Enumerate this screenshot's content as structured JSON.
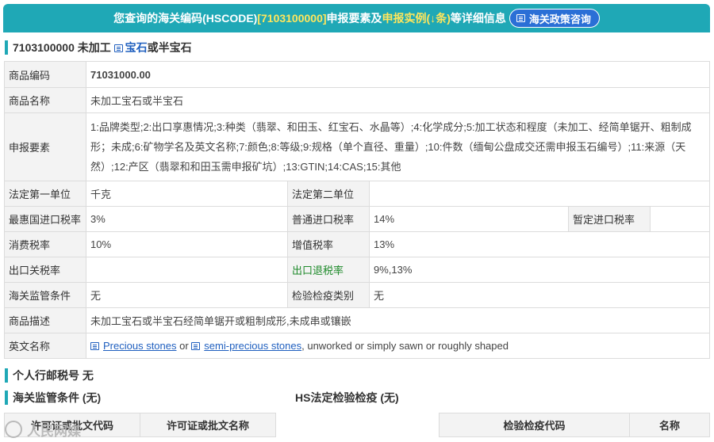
{
  "header": {
    "prefix": "您查询的海关编码(HSCODE)",
    "code_bracket": "[7103100000]",
    "mid": " 申报要素及",
    "example_link": "申报实例(↓条)",
    "suffix": "等详细信息",
    "policy_button": "海关政策咨询"
  },
  "title": {
    "code": "7103100000 未加工",
    "link": "宝石",
    "rest": "或半宝石"
  },
  "labels": {
    "code": "商品编码",
    "name": "商品名称",
    "elements": "申报要素",
    "unit1": "法定第一单位",
    "unit2": "法定第二单位",
    "mfn": "最惠国进口税率",
    "general": "普通进口税率",
    "provisional": "暂定进口税率",
    "consumption": "消费税率",
    "vat": "增值税率",
    "export_tax": "出口关税率",
    "export_rebate": "出口退税率",
    "supervision": "海关监管条件",
    "inspection": "检验检疫类别",
    "description": "商品描述",
    "english_name": "英文名称"
  },
  "values": {
    "code": "71031000.00",
    "name": "未加工宝石或半宝石",
    "elements": "1:品牌类型;2:出口享惠情况;3:种类（翡翠、和田玉、红宝石、水晶等）;4:化学成分;5:加工状态和程度（未加工、经简单锯开、粗制成形；未成;6:矿物学名及英文名称;7:颜色;8:等级;9:规格（单个直径、重量）;10:件数（缅甸公盘成交还需申报玉石编号）;11:来源（天然）;12:产区（翡翠和和田玉需申报矿坑）;13:GTIN;14:CAS;15:其他",
    "unit1": "千克",
    "unit2": "",
    "mfn": "3%",
    "general": "14%",
    "provisional": "",
    "consumption": "10%",
    "vat": "13%",
    "export_tax": "",
    "export_rebate": "9%,13%",
    "supervision": "无",
    "inspection": "无",
    "description": "未加工宝石或半宝石经简单锯开或粗制成形,未成串或镶嵌",
    "english_link1": "Precious stones",
    "english_or": " or ",
    "english_link2": "semi-precious stones",
    "english_rest": ", unworked or simply sawn or roughly shaped"
  },
  "sections": {
    "postal": "个人行邮税号 无",
    "supervision_conditions": "海关监管条件 (无)",
    "hs_inspection": "HS法定检验检疫 (无)"
  },
  "sub_tables": {
    "permit_code": "许可证或批文代码",
    "permit_name": "许可证或批文名称",
    "inspection_code": "检验检疫代码",
    "inspection_name": "名称"
  },
  "watermark": "人民网媒"
}
